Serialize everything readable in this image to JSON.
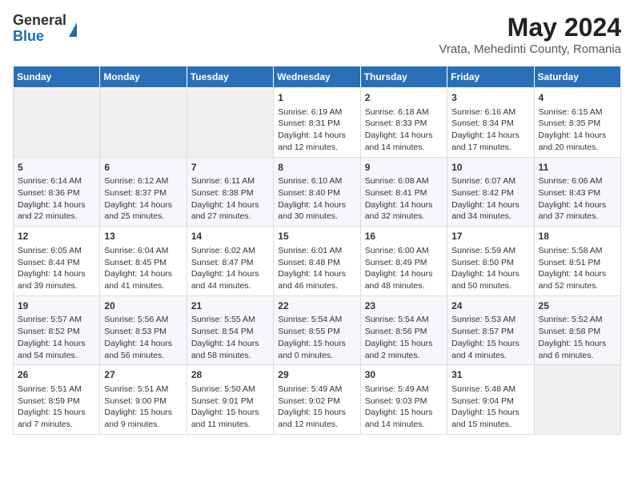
{
  "header": {
    "logo_general": "General",
    "logo_blue": "Blue",
    "title": "May 2024",
    "subtitle": "Vrata, Mehedinti County, Romania"
  },
  "calendar": {
    "days_of_week": [
      "Sunday",
      "Monday",
      "Tuesday",
      "Wednesday",
      "Thursday",
      "Friday",
      "Saturday"
    ],
    "weeks": [
      [
        {
          "day": "",
          "content": ""
        },
        {
          "day": "",
          "content": ""
        },
        {
          "day": "",
          "content": ""
        },
        {
          "day": "1",
          "content": "Sunrise: 6:19 AM\nSunset: 8:31 PM\nDaylight: 14 hours\nand 12 minutes."
        },
        {
          "day": "2",
          "content": "Sunrise: 6:18 AM\nSunset: 8:33 PM\nDaylight: 14 hours\nand 14 minutes."
        },
        {
          "day": "3",
          "content": "Sunrise: 6:16 AM\nSunset: 8:34 PM\nDaylight: 14 hours\nand 17 minutes."
        },
        {
          "day": "4",
          "content": "Sunrise: 6:15 AM\nSunset: 8:35 PM\nDaylight: 14 hours\nand 20 minutes."
        }
      ],
      [
        {
          "day": "5",
          "content": "Sunrise: 6:14 AM\nSunset: 8:36 PM\nDaylight: 14 hours\nand 22 minutes."
        },
        {
          "day": "6",
          "content": "Sunrise: 6:12 AM\nSunset: 8:37 PM\nDaylight: 14 hours\nand 25 minutes."
        },
        {
          "day": "7",
          "content": "Sunrise: 6:11 AM\nSunset: 8:38 PM\nDaylight: 14 hours\nand 27 minutes."
        },
        {
          "day": "8",
          "content": "Sunrise: 6:10 AM\nSunset: 8:40 PM\nDaylight: 14 hours\nand 30 minutes."
        },
        {
          "day": "9",
          "content": "Sunrise: 6:08 AM\nSunset: 8:41 PM\nDaylight: 14 hours\nand 32 minutes."
        },
        {
          "day": "10",
          "content": "Sunrise: 6:07 AM\nSunset: 8:42 PM\nDaylight: 14 hours\nand 34 minutes."
        },
        {
          "day": "11",
          "content": "Sunrise: 6:06 AM\nSunset: 8:43 PM\nDaylight: 14 hours\nand 37 minutes."
        }
      ],
      [
        {
          "day": "12",
          "content": "Sunrise: 6:05 AM\nSunset: 8:44 PM\nDaylight: 14 hours\nand 39 minutes."
        },
        {
          "day": "13",
          "content": "Sunrise: 6:04 AM\nSunset: 8:45 PM\nDaylight: 14 hours\nand 41 minutes."
        },
        {
          "day": "14",
          "content": "Sunrise: 6:02 AM\nSunset: 8:47 PM\nDaylight: 14 hours\nand 44 minutes."
        },
        {
          "day": "15",
          "content": "Sunrise: 6:01 AM\nSunset: 8:48 PM\nDaylight: 14 hours\nand 46 minutes."
        },
        {
          "day": "16",
          "content": "Sunrise: 6:00 AM\nSunset: 8:49 PM\nDaylight: 14 hours\nand 48 minutes."
        },
        {
          "day": "17",
          "content": "Sunrise: 5:59 AM\nSunset: 8:50 PM\nDaylight: 14 hours\nand 50 minutes."
        },
        {
          "day": "18",
          "content": "Sunrise: 5:58 AM\nSunset: 8:51 PM\nDaylight: 14 hours\nand 52 minutes."
        }
      ],
      [
        {
          "day": "19",
          "content": "Sunrise: 5:57 AM\nSunset: 8:52 PM\nDaylight: 14 hours\nand 54 minutes."
        },
        {
          "day": "20",
          "content": "Sunrise: 5:56 AM\nSunset: 8:53 PM\nDaylight: 14 hours\nand 56 minutes."
        },
        {
          "day": "21",
          "content": "Sunrise: 5:55 AM\nSunset: 8:54 PM\nDaylight: 14 hours\nand 58 minutes."
        },
        {
          "day": "22",
          "content": "Sunrise: 5:54 AM\nSunset: 8:55 PM\nDaylight: 15 hours\nand 0 minutes."
        },
        {
          "day": "23",
          "content": "Sunrise: 5:54 AM\nSunset: 8:56 PM\nDaylight: 15 hours\nand 2 minutes."
        },
        {
          "day": "24",
          "content": "Sunrise: 5:53 AM\nSunset: 8:57 PM\nDaylight: 15 hours\nand 4 minutes."
        },
        {
          "day": "25",
          "content": "Sunrise: 5:52 AM\nSunset: 8:58 PM\nDaylight: 15 hours\nand 6 minutes."
        }
      ],
      [
        {
          "day": "26",
          "content": "Sunrise: 5:51 AM\nSunset: 8:59 PM\nDaylight: 15 hours\nand 7 minutes."
        },
        {
          "day": "27",
          "content": "Sunrise: 5:51 AM\nSunset: 9:00 PM\nDaylight: 15 hours\nand 9 minutes."
        },
        {
          "day": "28",
          "content": "Sunrise: 5:50 AM\nSunset: 9:01 PM\nDaylight: 15 hours\nand 11 minutes."
        },
        {
          "day": "29",
          "content": "Sunrise: 5:49 AM\nSunset: 9:02 PM\nDaylight: 15 hours\nand 12 minutes."
        },
        {
          "day": "30",
          "content": "Sunrise: 5:49 AM\nSunset: 9:03 PM\nDaylight: 15 hours\nand 14 minutes."
        },
        {
          "day": "31",
          "content": "Sunrise: 5:48 AM\nSunset: 9:04 PM\nDaylight: 15 hours\nand 15 minutes."
        },
        {
          "day": "",
          "content": ""
        }
      ]
    ]
  }
}
